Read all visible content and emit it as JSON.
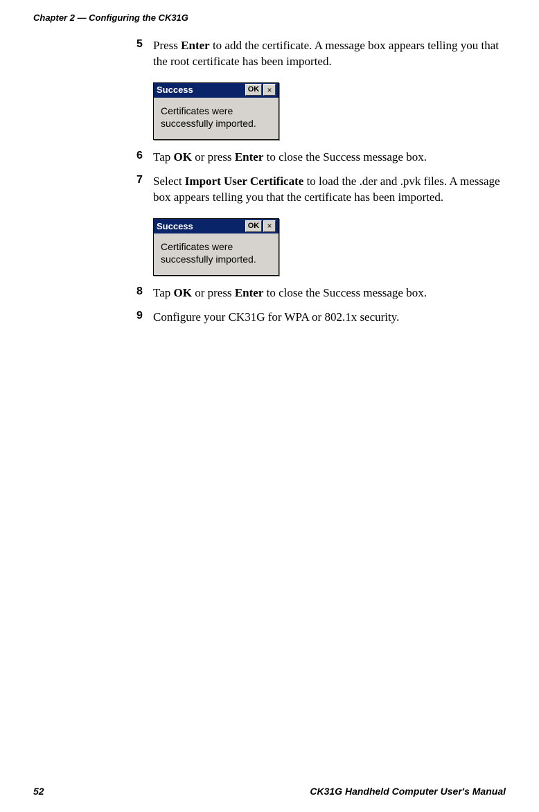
{
  "header": {
    "chapter": "Chapter 2 — Configuring the CK31G"
  },
  "steps": {
    "s5": {
      "num": "5",
      "pre": "Press ",
      "bold1": "Enter",
      "post": " to add the certificate. A message box appears telling you that the root certificate has been imported."
    },
    "s6": {
      "num": "6",
      "pre": "Tap ",
      "bold1": "OK",
      "mid": " or press ",
      "bold2": "Enter",
      "post": " to close the Success message box."
    },
    "s7": {
      "num": "7",
      "pre": "Select ",
      "bold1": "Import User Certificate",
      "post": " to load the .der and .pvk files. A message box appears telling you that the certificate has been imported."
    },
    "s8": {
      "num": "8",
      "pre": "Tap ",
      "bold1": "OK",
      "mid": " or press ",
      "bold2": "Enter",
      "post": " to close the Success message box."
    },
    "s9": {
      "num": "9",
      "text": "Configure your CK31G for WPA or 802.1x security."
    }
  },
  "dialog1": {
    "title": "Success",
    "ok": "OK",
    "close": "×",
    "body": "Certificates were successfully imported."
  },
  "dialog2": {
    "title": "Success",
    "ok": "OK",
    "close": "×",
    "body": "Certificates were successfully imported."
  },
  "footer": {
    "page": "52",
    "manual": "CK31G Handheld Computer User's Manual"
  }
}
